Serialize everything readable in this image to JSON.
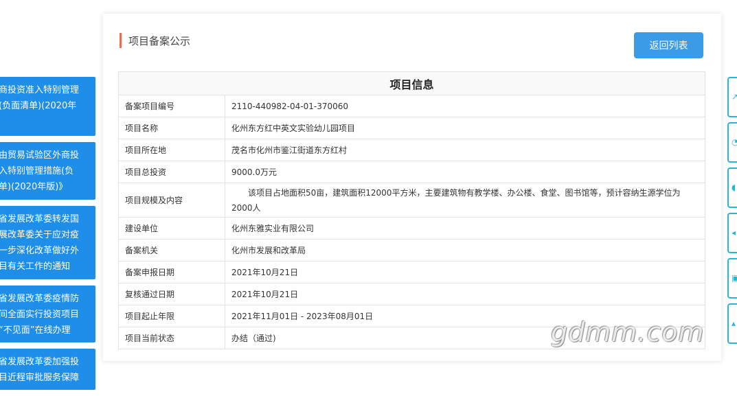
{
  "left_notices": [
    {
      "lines": [
        "商投资准入特别管理",
        "(负面清单)(2020年"
      ]
    },
    {
      "lines": [
        "由贸易试验区外商投",
        "入特别管理措施(负",
        "单)(2020年版)》"
      ]
    },
    {
      "lines": [
        "省发展改革委转发国",
        "展改革委关于应对疫",
        "一步深化改革做好外",
        "目有关工作的通知"
      ]
    },
    {
      "lines": [
        "省发展改革委疫情防",
        "间全面实行投资项目",
        "“不见面”在线办理"
      ]
    },
    {
      "lines": [
        "省发展改革委加强投",
        "目近程审批服务保障"
      ]
    }
  ],
  "page": {
    "title": "项目备案公示",
    "back_button": "返回列表"
  },
  "table": {
    "header": "项目信息",
    "rows": [
      {
        "label": "备案项目编号",
        "value": "2110-440982-04-01-370060"
      },
      {
        "label": "项目名称",
        "value": "化州东方红中英文实验幼儿园项目"
      },
      {
        "label": "项目所在地",
        "value": "茂名市化州市鉴江街道东方红村"
      },
      {
        "label": "项目总投资",
        "value": "9000.0万元"
      },
      {
        "label": "项目规模及内容",
        "value": "该项目占地面积50亩，建筑面积12000平方米，主要建筑物有教学楼、办公楼、食堂、图书馆等，预计容纳生源学位为2000人"
      },
      {
        "label": "建设单位",
        "value": "化州东雅实业有限公司"
      },
      {
        "label": "备案机关",
        "value": "化州市发展和改革局"
      },
      {
        "label": "备案申报日期",
        "value": "2021年10月21日"
      },
      {
        "label": "复核通过日期",
        "value": "2021年10月21日"
      },
      {
        "label": "项目起止年限",
        "value": "2021年11月01日 - 2023年08月01日"
      },
      {
        "label": "项目当前状态",
        "value": "办结（通过)"
      }
    ]
  },
  "watermark": "gdmm.com",
  "colors": {
    "accent_blue": "#1e8ee8",
    "button_blue": "#3c9be6",
    "title_accent": "#f06a48",
    "tool_border": "#28b7d3"
  },
  "right_tools": [
    {
      "icon": "share-icon"
    },
    {
      "icon": "user-icon"
    },
    {
      "icon": "chat-icon"
    },
    {
      "icon": "back-icon"
    },
    {
      "icon": "qr-icon"
    },
    {
      "icon": "top-icon"
    }
  ]
}
